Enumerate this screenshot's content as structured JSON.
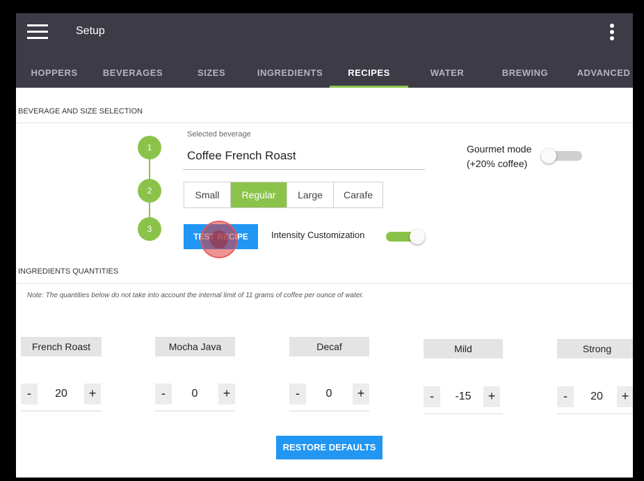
{
  "app": {
    "title": "Setup"
  },
  "tabs": [
    {
      "label": "HOPPERS"
    },
    {
      "label": "BEVERAGES"
    },
    {
      "label": "SIZES"
    },
    {
      "label": "INGREDIENTS"
    },
    {
      "label": "RECIPES",
      "active": true
    },
    {
      "label": "WATER"
    },
    {
      "label": "BREWING"
    },
    {
      "label": "ADVANCED"
    }
  ],
  "beverage_section": {
    "title": "BEVERAGE AND SIZE SELECTION",
    "steps": [
      "1",
      "2",
      "3"
    ],
    "selected_beverage_label": "Selected beverage",
    "selected_beverage": "Coffee French Roast",
    "sizes": [
      "Small",
      "Regular",
      "Large",
      "Carafe"
    ],
    "selected_size": "Regular",
    "gourmet_label_1": "Gourmet mode",
    "gourmet_label_2": "(+20% coffee)",
    "gourmet_on": false,
    "test_recipe": "TEST RECIPE",
    "intensity_label": "Intensity Customization",
    "intensity_on": true
  },
  "ingredients_section": {
    "title": "INGREDIENTS QUANTITIES",
    "note": "Note: The quantities below do not take into account the internal limit of 11 grams of coffee per ounce of water.",
    "items": [
      {
        "name": "French Roast",
        "value": "20"
      },
      {
        "name": "Mocha Java",
        "value": "0"
      },
      {
        "name": "Decaf",
        "value": "0"
      },
      {
        "name": "Mild",
        "value": "-15"
      },
      {
        "name": "Strong",
        "value": "20"
      }
    ],
    "minus": "-",
    "plus": "+",
    "restore_defaults": "RESTORE DEFAULTS"
  },
  "colors": {
    "accent_green": "#8bc34a",
    "accent_blue": "#2196f3",
    "appbar": "#3c3b46"
  }
}
